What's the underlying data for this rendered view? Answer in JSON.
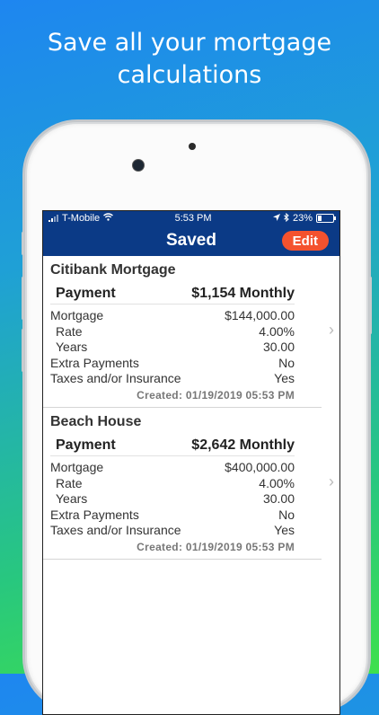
{
  "headline": {
    "line1": "Save all your mortgage",
    "line2": "calculations"
  },
  "statusbar": {
    "carrier": "T-Mobile",
    "time": "5:53 PM",
    "battery": "23%"
  },
  "navbar": {
    "title": "Saved",
    "edit_label": "Edit"
  },
  "colors": {
    "nav_bg": "#0b3a86",
    "edit_btn": "#f4522e"
  },
  "labels": {
    "payment": "Payment",
    "mortgage": "Mortgage",
    "rate": "Rate",
    "years": "Years",
    "extra": "Extra Payments",
    "taxes": "Taxes and/or Insurance"
  },
  "items": [
    {
      "name": "Citibank Mortgage",
      "payment": "$1,154 Monthly",
      "mortgage": "$144,000.00",
      "rate": "4.00%",
      "years": "30.00",
      "extra": "No",
      "taxes": "Yes",
      "created": "Created: 01/19/2019 05:53 PM"
    },
    {
      "name": "Beach House",
      "payment": "$2,642 Monthly",
      "mortgage": "$400,000.00",
      "rate": "4.00%",
      "years": "30.00",
      "extra": "No",
      "taxes": "Yes",
      "created": "Created: 01/19/2019 05:53 PM"
    }
  ]
}
